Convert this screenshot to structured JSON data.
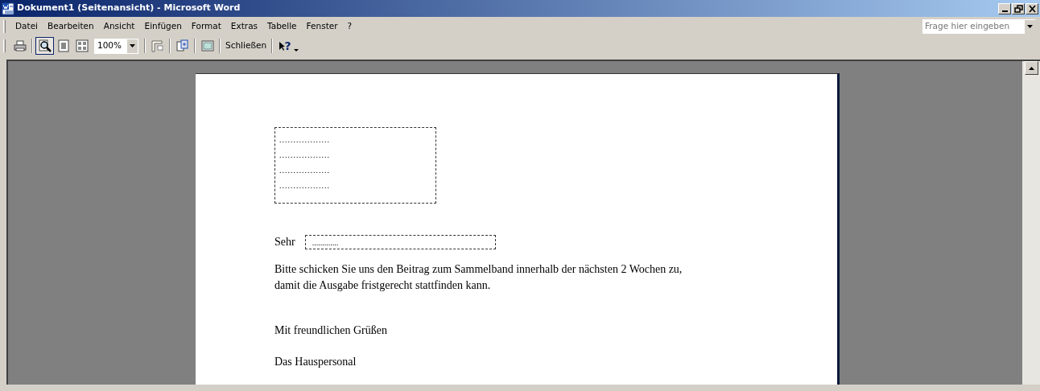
{
  "window": {
    "title": "Dokument1 (Seitenansicht) - Microsoft Word"
  },
  "menu": [
    {
      "label": "Datei"
    },
    {
      "label": "Bearbeiten"
    },
    {
      "label": "Ansicht"
    },
    {
      "label": "Einfügen"
    },
    {
      "label": "Format"
    },
    {
      "label": "Extras"
    },
    {
      "label": "Tabelle"
    },
    {
      "label": "Fenster"
    },
    {
      "label": "?"
    }
  ],
  "help_box": {
    "placeholder": "Frage hier eingeben"
  },
  "toolbar": [
    {
      "kind": "print",
      "pressed": false
    },
    {
      "kind": "separator"
    },
    {
      "kind": "magnifier",
      "pressed": true
    },
    {
      "kind": "onepage",
      "pressed": false
    },
    {
      "kind": "multipage",
      "pressed": false
    },
    {
      "kind": "zoom",
      "value": "100%"
    },
    {
      "kind": "separator"
    },
    {
      "kind": "ruler",
      "pressed": false
    },
    {
      "kind": "separator"
    },
    {
      "kind": "shrink",
      "pressed": false
    },
    {
      "kind": "separator"
    },
    {
      "kind": "fullscreen",
      "pressed": false
    },
    {
      "kind": "separator"
    },
    {
      "kind": "text",
      "label": "Schließen",
      "pressed": false
    },
    {
      "kind": "separator"
    },
    {
      "kind": "help",
      "label": "?",
      "pressed": false
    }
  ],
  "document": {
    "address_lines": [
      "..................",
      "..................",
      "..................",
      ".................."
    ],
    "salutation": {
      "label": "Sehr",
      "value": "............."
    },
    "body_lines": [
      "Bitte schicken Sie uns den Beitrag zum Sammelband innerhalb der nächsten 2 Wochen zu,",
      "damit die Ausgabe fristgerecht stattfinden kann."
    ],
    "closing": "Mit freundlichen Grüßen",
    "signature": "Das Hauspersonal"
  }
}
